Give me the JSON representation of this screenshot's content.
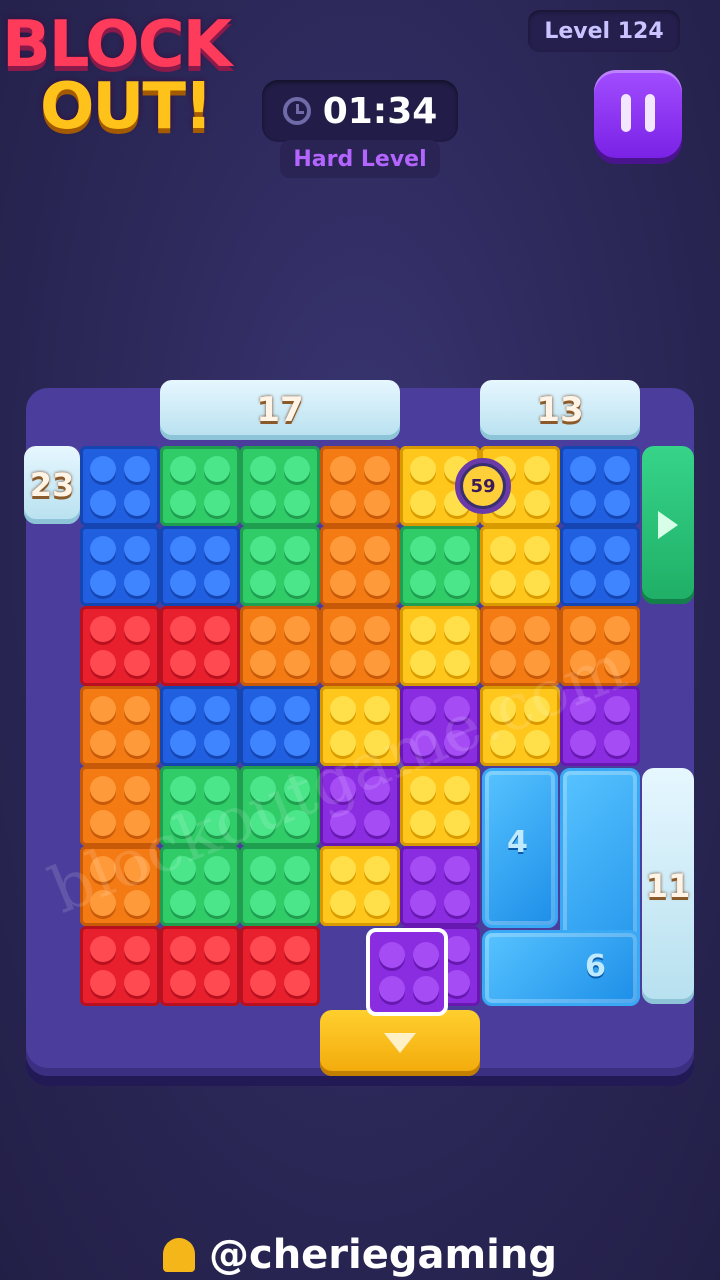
{
  "logo": {
    "line1": "BLOCK",
    "line2": "OUT!"
  },
  "header": {
    "level": "Level 124",
    "timer": "01:34",
    "difficulty": "Hard Level"
  },
  "gates": {
    "top_left": "17",
    "top_right": "13",
    "left": "23",
    "right": "11"
  },
  "bomb": {
    "count": "59"
  },
  "ice_blocks": {
    "left": "4",
    "right": "6"
  },
  "watermark": "blockoutgame.com",
  "credit": "@cheriegaming",
  "colors": {
    "red": "#e8202e",
    "orange": "#f47a14",
    "yellow": "#ffc61c",
    "green": "#2fcc68",
    "blue": "#1f5fe0",
    "purple": "#8a2ce0"
  },
  "grid": [
    [
      "blue",
      "green",
      "green",
      "orange",
      "yellow",
      "yellow",
      "blue"
    ],
    [
      "blue",
      "blue",
      "green",
      "orange",
      "green",
      "yellow",
      "blue"
    ],
    [
      "red",
      "red",
      "orange",
      "orange",
      "yellow",
      "orange",
      "orange"
    ],
    [
      "orange",
      "blue",
      "blue",
      "yellow",
      "purple",
      "yellow",
      "purple"
    ],
    [
      "orange",
      "green",
      "green",
      "purple",
      "yellow",
      "ice",
      "ice"
    ],
    [
      "orange",
      "green",
      "green",
      "yellow",
      "purple",
      "ice",
      "ice"
    ],
    [
      "red",
      "red",
      "red",
      "empty",
      "purple",
      "ice",
      "ice"
    ]
  ]
}
